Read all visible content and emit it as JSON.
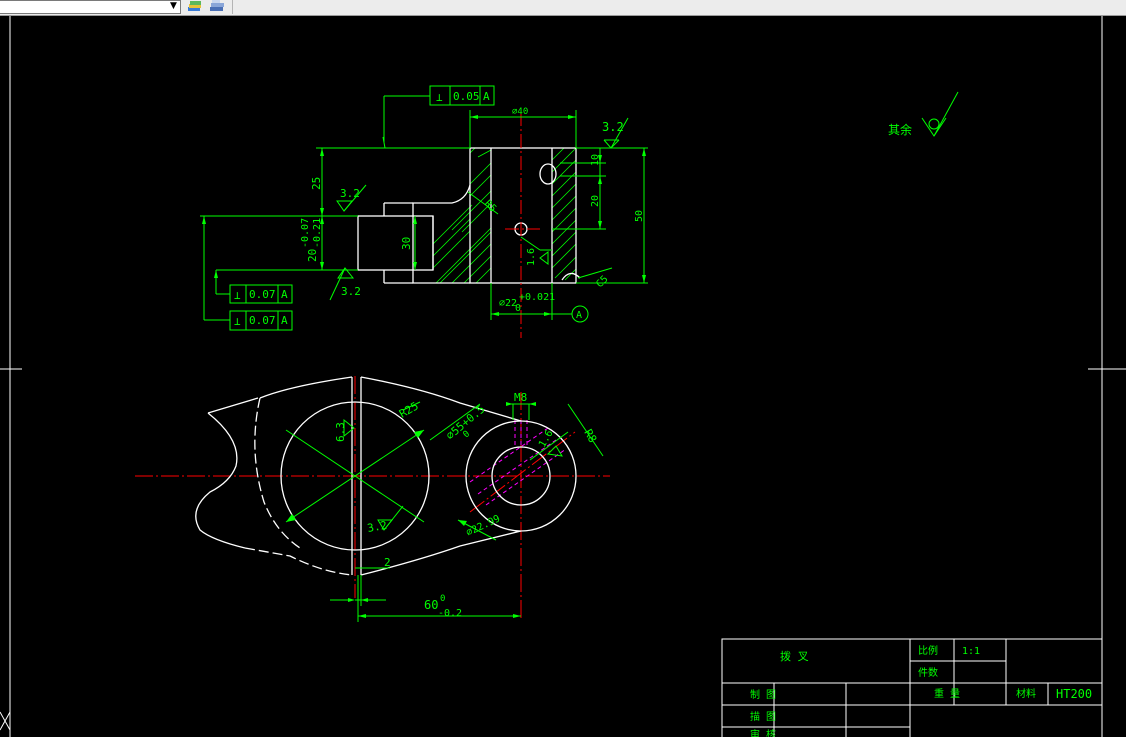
{
  "colors": {
    "background": "#000000",
    "dimension": "#00ff00",
    "geometry": "#ffffff",
    "centerline": "#ff0000",
    "hidden": "#ff00ff",
    "frame": "#ffffff"
  },
  "toolbar": {
    "layer_combo_value": "",
    "combo_arrow_icon": "chevron-down-icon",
    "buttons": [
      "layer-properties-icon",
      "layer-states-icon"
    ]
  },
  "drawing": {
    "top_view": {
      "gdt_top": {
        "symbol": "⊥",
        "value": "0.05",
        "datum": "A"
      },
      "gdt_left_1": {
        "symbol": "⊥",
        "value": "0.07",
        "datum": "A"
      },
      "gdt_left_2": {
        "symbol": "⊥",
        "value": "0.07",
        "datum": "A"
      },
      "dim_width": "⌀40",
      "dim_height_25": "25",
      "dim_left": "20",
      "dim_left_tol_upper": "-0.07",
      "dim_left_tol_lower": "-0.21",
      "dim_30": "30",
      "dim_10": "10",
      "dim_20": "20",
      "dim_50": "50",
      "dim_r5": "R5",
      "dim_c5": "C5",
      "dim_bore": "⌀22",
      "dim_bore_tol": "+0.021",
      "dim_bore_zero": "0",
      "rough_left_top": "3.2",
      "rough_left_bottom": "3.2",
      "rough_right": "3.2",
      "rough_inner": "1.6",
      "datum_label": "A"
    },
    "front_view": {
      "dim_r25": "R25",
      "dim_d55": "⌀55+0.5",
      "dim_d55_zero": "0",
      "dim_63": "6.3",
      "dim_32": "3.2",
      "dim_m8": "M8",
      "dim_16": "1.6",
      "dim_r8": "R8",
      "dim_d22": "⌀22.99",
      "dim_2": "2",
      "dim_60": "60",
      "dim_60_tol_upper": "0",
      "dim_60_tol_lower": "-0.2"
    },
    "surface_note": "其余"
  },
  "title_block": {
    "name": "拨 叉",
    "scale_label": "比例",
    "scale_value": "1:1",
    "qty_label": "件数",
    "row_designed": "制 图",
    "row_drawn": "描 图",
    "row_checked": "审 核",
    "weight_label": "重 量",
    "material_label": "材料",
    "material_value": "HT200"
  }
}
